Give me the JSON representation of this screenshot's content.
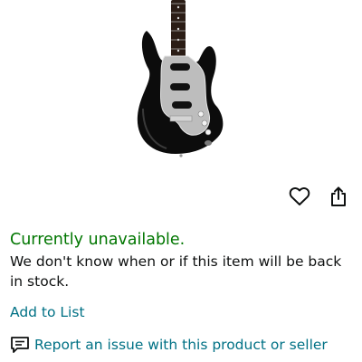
{
  "product": {
    "image_alt": "electric-guitar-image"
  },
  "actions": {
    "wishlist_icon": "heart-icon",
    "share_icon": "share-icon"
  },
  "availability": {
    "status": "Currently unavailable.",
    "detail": "We don't know when or if this item will be back in stock.",
    "status_color": "#007600"
  },
  "links": {
    "add_to_list": "Add to List",
    "report_issue": "Report an issue with this product or seller",
    "link_color": "#007185"
  }
}
